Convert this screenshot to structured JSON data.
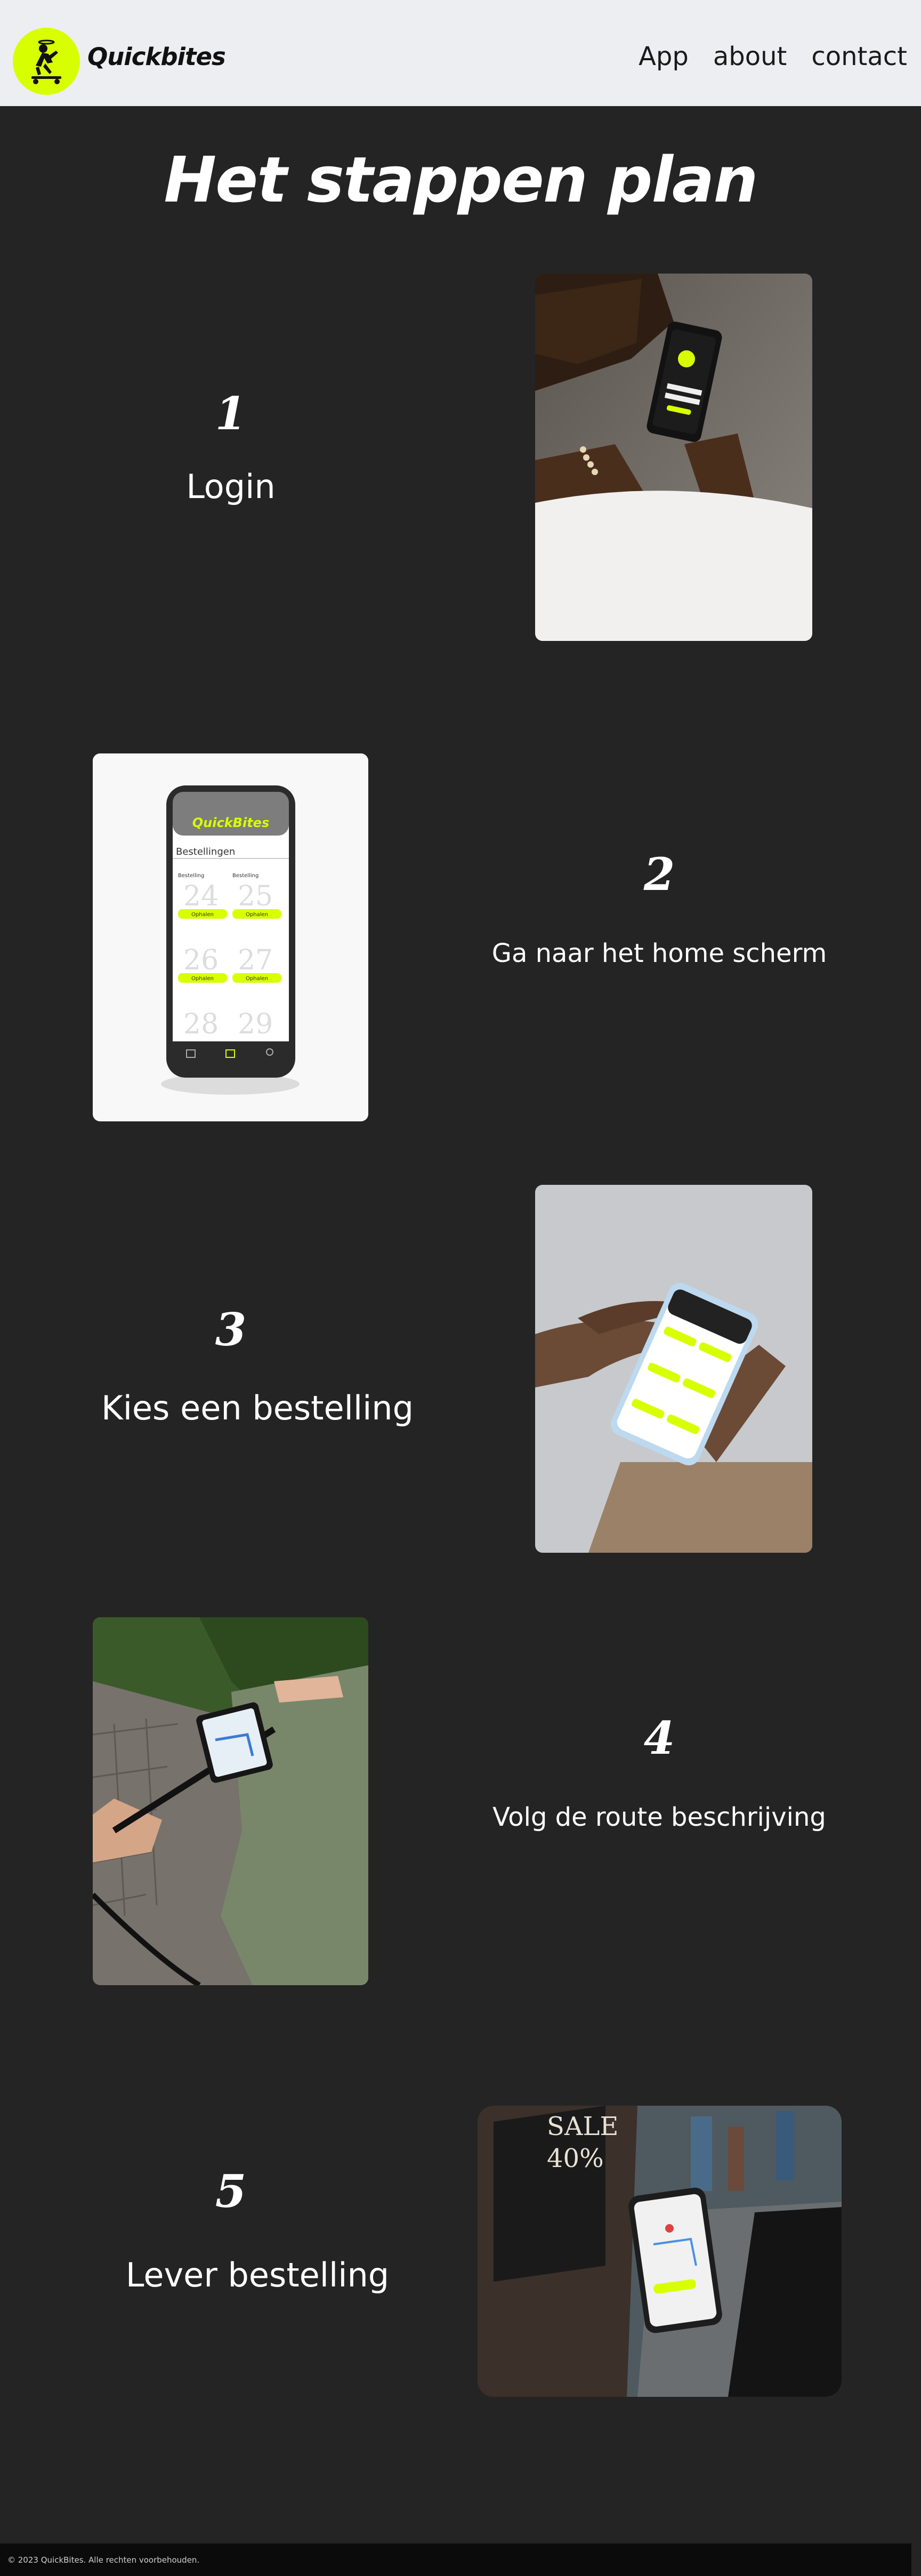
{
  "nav": {
    "brand": "Quickbites",
    "links": [
      "App",
      "about",
      "contact"
    ]
  },
  "page": {
    "title": "Het stappen plan"
  },
  "steps": [
    {
      "number": "1",
      "label": "Login"
    },
    {
      "number": "2",
      "label": "Ga naar het home scherm"
    },
    {
      "number": "3",
      "label": "Kies een bestelling"
    },
    {
      "number": "4",
      "label": "Volg de route beschrijving"
    },
    {
      "number": "5",
      "label": "Lever bestelling"
    }
  ],
  "photos": {
    "app_brand": "QuickBites",
    "app_heading": "Bestellingen",
    "order_label": "Bestelling",
    "order_button": "Ophalen",
    "order_numbers": [
      "24",
      "25",
      "26",
      "27",
      "28",
      "29"
    ],
    "shop_sign_1": "SALE",
    "shop_sign_2": "40%"
  },
  "footer": {
    "text": "© 2023 QuickBites. Alle rechten voorbehouden."
  },
  "colors": {
    "background": "#242424",
    "nav_background": "#edeef1",
    "accent": "#d8ff00",
    "footer_background": "#0b0b0b"
  }
}
